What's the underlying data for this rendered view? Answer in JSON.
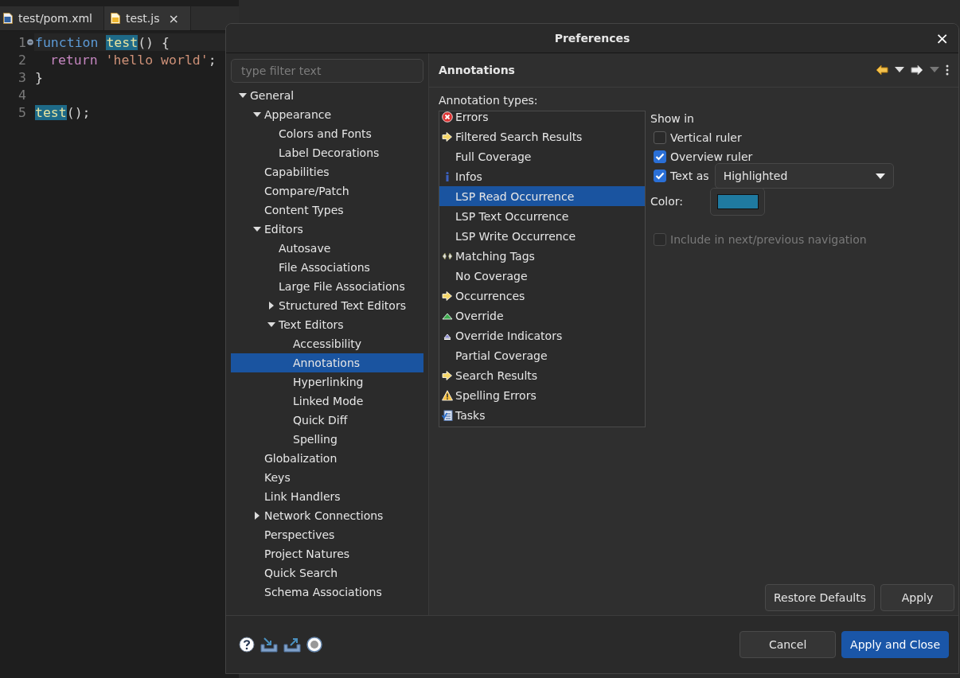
{
  "editor": {
    "tabs": [
      {
        "label": "test/pom.xml",
        "kind": "xml",
        "selected": false
      },
      {
        "label": "test.js",
        "kind": "js",
        "selected": true,
        "close": "×"
      }
    ],
    "lines": [
      {
        "number": "1",
        "folded": false,
        "tokens": [
          {
            "kind": "keyword",
            "text": "function "
          },
          {
            "kind": "occurrence",
            "text": "test"
          },
          {
            "kind": "punct",
            "text": "() {"
          }
        ]
      },
      {
        "number": "2",
        "indented": true,
        "tokens": [
          {
            "kind": "control",
            "text": "return "
          },
          {
            "kind": "string",
            "text": "'hello world'"
          },
          {
            "kind": "punct",
            "text": ";"
          }
        ]
      },
      {
        "number": "3",
        "tokens": [
          {
            "kind": "punct",
            "text": "}"
          }
        ]
      },
      {
        "number": "4"
      },
      {
        "number": "5",
        "tokens": [
          {
            "kind": "occurrence",
            "text": "test"
          },
          {
            "kind": "punct",
            "text": "();"
          }
        ]
      }
    ]
  },
  "dialog": {
    "title": "Preferences",
    "close": "×",
    "filter": {
      "placeholder": "type filter text"
    },
    "tree": [
      {
        "label": "General",
        "expanded": true,
        "selected": false,
        "children": [
          {
            "label": "Appearance",
            "expanded": true,
            "selected": false,
            "children": [
              {
                "label": "Colors and Fonts",
                "selected": false
              },
              {
                "label": "Label Decorations",
                "selected": false
              }
            ]
          },
          {
            "label": "Capabilities",
            "selected": false
          },
          {
            "label": "Compare/Patch",
            "selected": false
          },
          {
            "label": "Content Types",
            "selected": false
          },
          {
            "label": "Editors",
            "expanded": true,
            "selected": false,
            "children": [
              {
                "label": "Autosave",
                "selected": false
              },
              {
                "label": "File Associations",
                "selected": false
              },
              {
                "label": "Large File Associations",
                "selected": false
              },
              {
                "label": "Structured Text Editors",
                "expanded": false,
                "selected": false
              },
              {
                "label": "Text Editors",
                "expanded": true,
                "selected": false,
                "children": [
                  {
                    "label": "Accessibility",
                    "selected": false
                  },
                  {
                    "label": "Annotations",
                    "selected": true
                  },
                  {
                    "label": "Hyperlinking",
                    "selected": false
                  },
                  {
                    "label": "Linked Mode",
                    "selected": false
                  },
                  {
                    "label": "Quick Diff",
                    "selected": false
                  },
                  {
                    "label": "Spelling",
                    "selected": false
                  }
                ]
              }
            ]
          },
          {
            "label": "Globalization",
            "selected": false
          },
          {
            "label": "Keys",
            "selected": false
          },
          {
            "label": "Link Handlers",
            "selected": false
          },
          {
            "label": "Network Connections",
            "expanded": false,
            "selected": false
          },
          {
            "label": "Perspectives",
            "selected": false
          },
          {
            "label": "Project Natures",
            "selected": false
          },
          {
            "label": "Quick Search",
            "selected": false
          },
          {
            "label": "Schema Associations",
            "selected": false
          }
        ]
      }
    ],
    "page": {
      "title": "Annotations",
      "types_label": "Annotation types:",
      "types": [
        {
          "label": "Errors",
          "kind": "error",
          "selected": false
        },
        {
          "label": "Filtered Search Results",
          "kind": "arrow",
          "selected": false
        },
        {
          "label": "Full Coverage",
          "kind": "plain",
          "selected": false
        },
        {
          "label": "Infos",
          "kind": "info",
          "selected": false
        },
        {
          "label": "LSP Read Occurrence",
          "kind": "plain",
          "selected": true
        },
        {
          "label": "LSP Text Occurrence",
          "kind": "plain",
          "selected": false
        },
        {
          "label": "LSP Write Occurrence",
          "kind": "plain",
          "selected": false
        },
        {
          "label": "Matching Tags",
          "kind": "tags",
          "selected": false
        },
        {
          "label": "No Coverage",
          "kind": "plain",
          "selected": false
        },
        {
          "label": "Occurrences",
          "kind": "arrow",
          "selected": false
        },
        {
          "label": "Override",
          "kind": "override",
          "selected": false
        },
        {
          "label": "Override Indicators",
          "kind": "indicator",
          "selected": false
        },
        {
          "label": "Partial Coverage",
          "kind": "plain",
          "selected": false
        },
        {
          "label": "Search Results",
          "kind": "arrow",
          "selected": false
        },
        {
          "label": "Spelling Errors",
          "kind": "warning",
          "selected": false
        },
        {
          "label": "Tasks",
          "kind": "tasks",
          "selected": false
        }
      ],
      "show_in_label": "Show in",
      "vertical_ruler": {
        "label": "Vertical ruler",
        "checked": false
      },
      "overview_ruler": {
        "label": "Overview ruler",
        "checked": true
      },
      "text_as": {
        "label": "Text as",
        "checked": true,
        "value": "Highlighted"
      },
      "color": {
        "label": "Color:",
        "color": "#1f7aa0"
      },
      "navigation": {
        "label": "Include in next/previous navigation",
        "checked": false,
        "disabled": true
      },
      "buttons": [
        {
          "label": "Restore Defaults",
          "kind": "normal"
        },
        {
          "label": "Apply",
          "kind": "normal"
        }
      ]
    },
    "footer_buttons": [
      {
        "label": "Cancel",
        "kind": "normal"
      },
      {
        "label": "Apply and Close",
        "kind": "primary"
      }
    ]
  }
}
